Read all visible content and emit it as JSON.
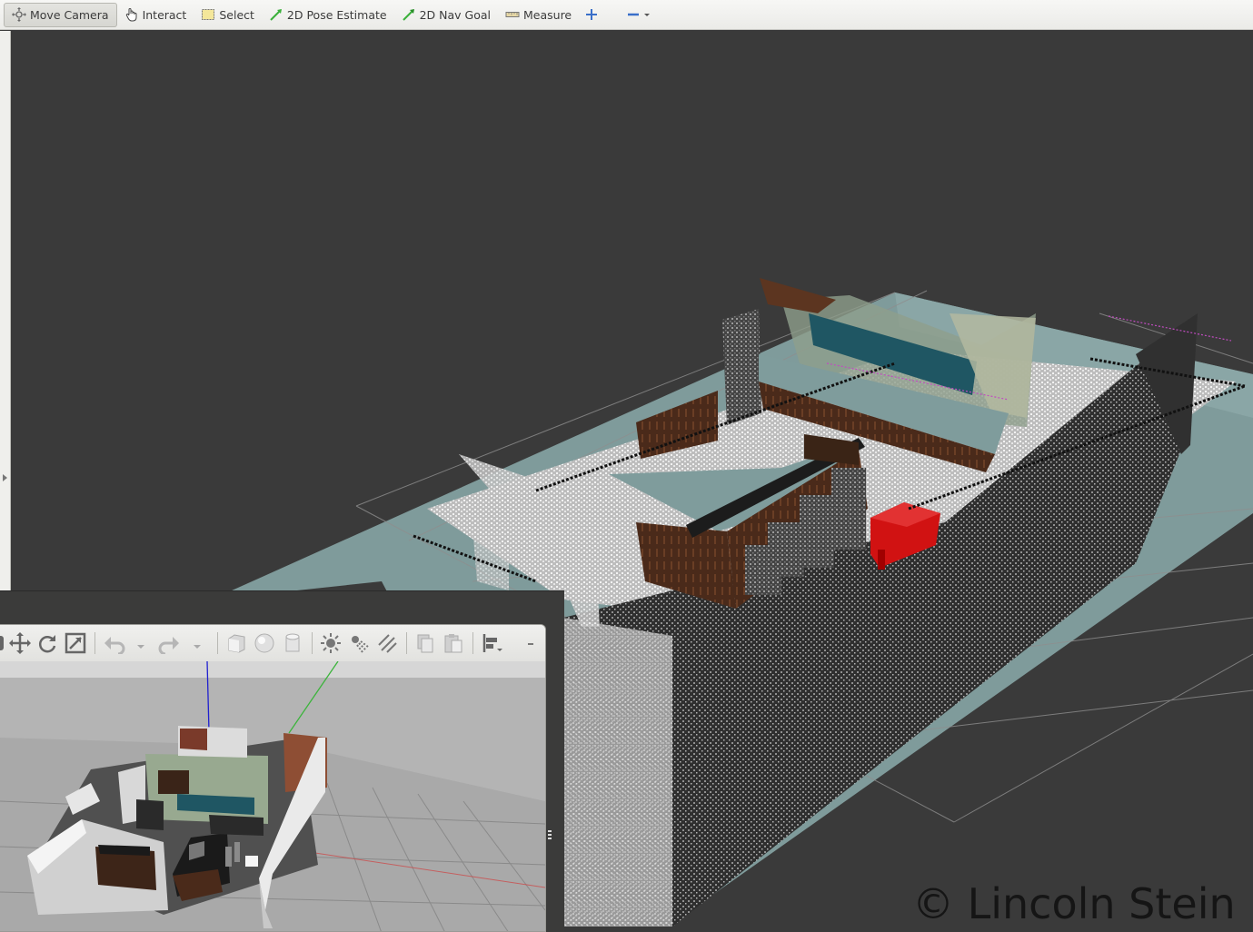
{
  "toolbar": {
    "tools": [
      {
        "label": "Move Camera",
        "icon": "move-camera-icon",
        "active": true
      },
      {
        "label": "Interact",
        "icon": "hand-icon"
      },
      {
        "label": "Select",
        "icon": "select-box-icon"
      },
      {
        "label": "2D Pose Estimate",
        "icon": "pose-arrow-icon"
      },
      {
        "label": "2D Nav Goal",
        "icon": "goal-arrow-icon"
      },
      {
        "label": "Measure",
        "icon": "ruler-icon"
      }
    ]
  },
  "watermark": "© Lincoln Stein",
  "colors": {
    "viewport_bg": "#3a3a3a",
    "floor": "#7f9c9c",
    "points": "#d9d9d9",
    "red_object": "#cc1010",
    "toolbar_bg": "#ebebe8"
  }
}
